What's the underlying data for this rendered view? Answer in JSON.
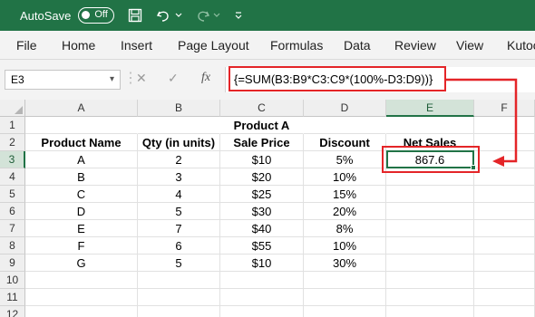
{
  "titlebar": {
    "autosave": "AutoSave",
    "toggle": "Off"
  },
  "ribbon": {
    "tabs": [
      "File",
      "Home",
      "Insert",
      "Page Layout",
      "Formulas",
      "Data",
      "Review",
      "View",
      "Kutools"
    ]
  },
  "formula_bar": {
    "name_box": "E3",
    "cancel": "✕",
    "enter": "✓",
    "fx": "fx",
    "formula": "{=SUM(B3:B9*C3:C9*(100%-D3:D9))}"
  },
  "sheet": {
    "columns": [
      "A",
      "B",
      "C",
      "D",
      "E",
      "F"
    ],
    "rows": [
      "1",
      "2",
      "3",
      "4",
      "5",
      "6",
      "7",
      "8",
      "9",
      "10",
      "11",
      "12"
    ],
    "title": "Product A",
    "headers": [
      "Product Name",
      "Qty (in units)",
      "Sale Price",
      "Discount",
      "Net Sales"
    ],
    "data": [
      [
        "A",
        "2",
        "$10",
        "5%"
      ],
      [
        "B",
        "3",
        "$20",
        "10%"
      ],
      [
        "C",
        "4",
        "$25",
        "15%"
      ],
      [
        "D",
        "5",
        "$30",
        "20%"
      ],
      [
        "E",
        "7",
        "$40",
        "8%"
      ],
      [
        "F",
        "6",
        "$55",
        "10%"
      ],
      [
        "G",
        "5",
        "$10",
        "30%"
      ]
    ],
    "result": "867.6",
    "active_cell": "E3"
  },
  "colors": {
    "excel_green": "#217346",
    "annotation_red": "#e42528"
  }
}
